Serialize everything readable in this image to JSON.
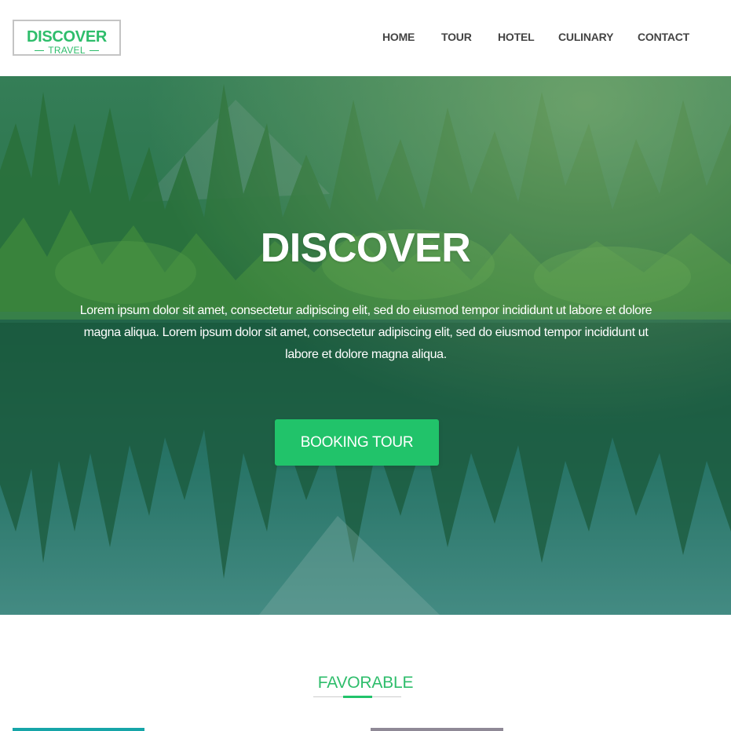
{
  "logo": {
    "name": "DISCOVER",
    "tagline": "TRAVEL"
  },
  "nav": {
    "items": [
      {
        "label": "HOME"
      },
      {
        "label": "TOUR"
      },
      {
        "label": "HOTEL"
      },
      {
        "label": "CULINARY"
      },
      {
        "label": "CONTACT"
      }
    ]
  },
  "hero": {
    "title": "DISCOVER",
    "text": "Lorem ipsum dolor sit amet, consectetur adipiscing elit, sed do eiusmod tempor incididunt ut labore et dolore magna aliqua. Lorem ipsum dolor sit amet, consectetur adipiscing elit, sed do eiusmod tempor incididunt ut labore et dolore magna aliqua.",
    "button_label": "BOOKING TOUR"
  },
  "favorable": {
    "title": "FAVORABLE"
  },
  "colors": {
    "brand_green": "#2ebd6b",
    "button_green": "#21c36a",
    "nav_text": "#444444"
  }
}
